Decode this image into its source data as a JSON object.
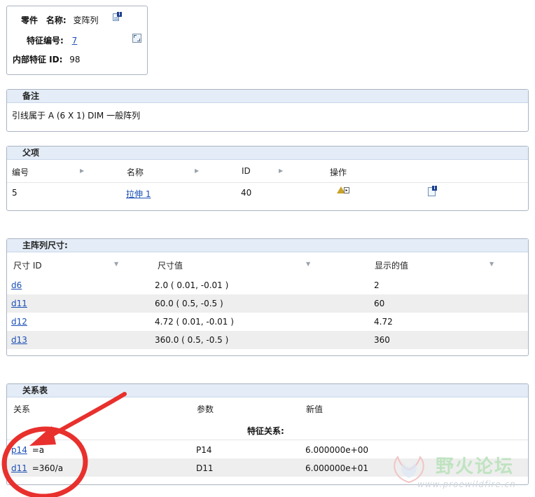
{
  "info": {
    "type_label": "零件",
    "name_label": "名称:",
    "name_value": "变阵列",
    "feature_no_label": "特征编号:",
    "feature_no_value": "7",
    "internal_id_label": "内部特征  ID:",
    "internal_id_value": "98"
  },
  "notes": {
    "title": "备注",
    "text": "引线属于  A (6 X 1) DIM 一般阵列"
  },
  "parents": {
    "title": "父项",
    "headers": [
      "编号",
      "名称",
      "ID",
      "操作"
    ],
    "row": {
      "no": "5",
      "name": "拉伸 1",
      "id": "40"
    }
  },
  "dims": {
    "title": "主阵列尺寸:",
    "headers": [
      "尺寸 ID",
      "尺寸值",
      "显示的值"
    ],
    "rows": [
      {
        "id": "d6",
        "value": "2.0 ( 0.01, -0.01 )",
        "shown": "2"
      },
      {
        "id": "d11",
        "value": "60.0 ( 0.5, -0.5 )",
        "shown": "60"
      },
      {
        "id": "d12",
        "value": "4.72 ( 0.01, -0.01 )",
        "shown": "4.72"
      },
      {
        "id": "d13",
        "value": "360.0 ( 0.5, -0.5 )",
        "shown": "360"
      }
    ]
  },
  "relations": {
    "title": "关系表",
    "headers": [
      "关系",
      "参数",
      "新值"
    ],
    "subtitle": "特征关系:",
    "rows": [
      {
        "ref": "p14",
        "expr": "=a",
        "param": "P14",
        "value": "6.000000e+00"
      },
      {
        "ref": "d11",
        "expr": "=360/a",
        "param": "D11",
        "value": "6.000000e+01"
      }
    ]
  },
  "watermark": {
    "text": "野火论坛",
    "url": "www.proewildfire.cn"
  },
  "colors": {
    "section_header": "#e3ecf7",
    "link": "#1a4fb5",
    "annotation": "#e8302d"
  }
}
